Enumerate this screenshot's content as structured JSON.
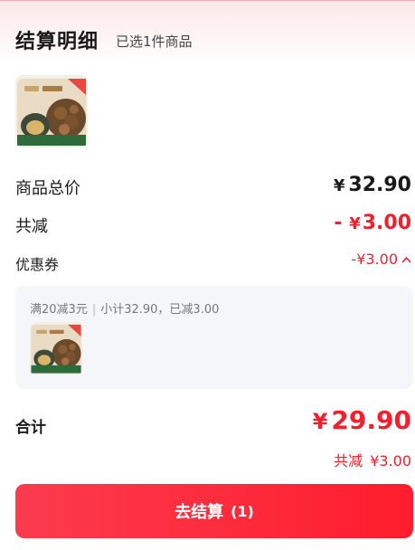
{
  "header": {
    "title": "结算明细",
    "subtitle": "已选1件商品"
  },
  "product": {
    "thumbnail_icon": "product-package-image"
  },
  "summary": {
    "goods_total_label": "商品总价",
    "goods_total_currency": "¥",
    "goods_total_value": "32.90",
    "reduction_label": "共减",
    "reduction_sign": "-",
    "reduction_currency": "¥",
    "reduction_value": "3.00",
    "coupon_label": "优惠券",
    "coupon_value": "-¥3.00"
  },
  "coupon_detail": {
    "rule": "满20减3元",
    "detail": "小计32.90，已减3.00"
  },
  "total": {
    "label": "合计",
    "currency": "¥",
    "value": "29.90",
    "saved_label": "共减",
    "saved_value": "¥3.00"
  },
  "checkout": {
    "label": "去结算",
    "count": "(1)"
  },
  "colors": {
    "accent": "#f0202e",
    "button_start": "#fb3b4e",
    "button_end": "#ff1d2d"
  }
}
